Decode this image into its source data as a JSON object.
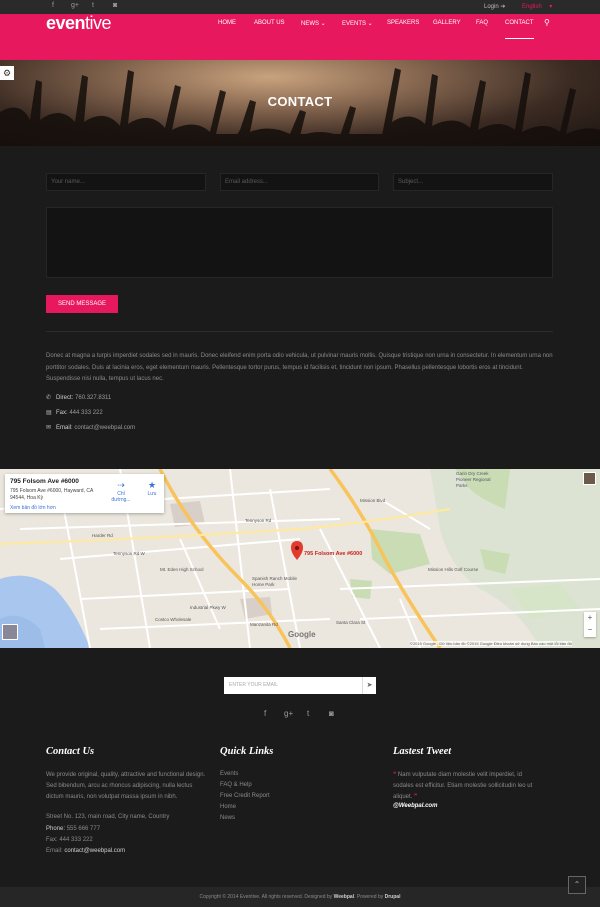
{
  "topbar": {
    "social": [
      {
        "icon": "facebook-icon",
        "glyph": "f"
      },
      {
        "icon": "google-plus-icon",
        "glyph": "g+"
      },
      {
        "icon": "twitter-icon",
        "glyph": "t"
      },
      {
        "icon": "instagram-icon",
        "glyph": "◙"
      }
    ],
    "login_label": "Login ➔",
    "language_label": "English"
  },
  "brand": {
    "logo_part1": "even",
    "logo_part2": "tive",
    "accent_color": "#e8185e"
  },
  "nav": {
    "items": [
      "HOME",
      "ABOUT US",
      "NEWS ⌄",
      "EVENTS ⌄",
      "SPEAKERS",
      "GALLERY",
      "FAQ",
      "CONTACT"
    ],
    "active": "CONTACT"
  },
  "hero": {
    "title": "CONTACT"
  },
  "form": {
    "name_placeholder": "Your name...",
    "email_placeholder": "Email address...",
    "subject_placeholder": "Subject...",
    "send_label": "SEND MESSAGE"
  },
  "contact": {
    "paragraph": "Donec at magna a turpis imperdiet sodales sed in mauris. Donec eleifend enim porta odio vehicula, ut pulvinar mauris mollis. Quisque tristique non urna in consectetur. In elementum urna non porttitor sodales. Duis at lacinia eros, eget elementum mauris. Pellentesque tortor purus, tempus id facilisis et, tincidunt non ipsum. Phasellus pellentesque lobortis eros at tincidunt. Suspendisse nisi nulla, tempus ut lacus nec.",
    "direct_label": "Direct:",
    "direct_value": "760.327.8311",
    "fax_label": "Fax:",
    "fax_value": "444 333 222",
    "email_label": "Email:",
    "email_value": "contact@weebpal.com"
  },
  "map": {
    "card_title": "795 Folsom Ave #6000",
    "card_address": "795 Folsom Ave #6000, Hayward, CA 94544, Hoa Kỳ",
    "card_link": "Xem bản đồ lớn hơn",
    "directions_label": "Chỉ đường...",
    "save_label": "Lưu",
    "pin_label": "795 Folsom Ave #6000",
    "street_labels": [
      "Mission Hills Golf Course",
      "Mt. Eden High School",
      "Spanish Ranch Mobile Home Park",
      "Costco Wholesale",
      "Garin Dry Creek Pioneer Regional Parks",
      "Tennyson Rd",
      "Industrial Pkwy W",
      "Mission Blvd",
      "Manzanita Rd",
      "Santa Clara St",
      "Harder Rd",
      "Tennyson Rd W"
    ],
    "zoom_in": "+",
    "zoom_out": "−",
    "footer_text": "©2015 Google - Dữ liệu bản đồ ©2015 Google   Điều khoản sử dụng   Báo cáo một lỗi bản đồ",
    "google_logo": "Google"
  },
  "newsletter": {
    "placeholder": "ENTER YOUR EMAIL"
  },
  "footer": {
    "contact_heading": "Contact Us",
    "contact_text": "We provide original, quality, attractive and functional design. Sed bibendum, arcu ac rhoncus adipiscing, nulla lectus dictum mauris, non volutpat massa ipsum in nibh.",
    "street": "Street No. 123, main road, City name, Country",
    "phone_label": "Phone:",
    "phone_value": "555 666 777",
    "fax_label": "Fax:",
    "fax_value": "444 333 222",
    "email_label": "Email:",
    "email_value": "contact@weebpal.com",
    "links_heading": "Quick Links",
    "links": [
      "Events",
      "FAQ & Help",
      "Free Credit Report",
      "Home",
      "News"
    ],
    "tweet_heading": "Lastest Tweet",
    "tweet_text": "Nam vulputate diam molestie velit imperdiet, id sodales est efficitur. Etiam molestie sollicitudin leo ut aliquet.",
    "tweet_handle": "@Weebpal.com"
  },
  "copyright": {
    "prefix": "Copyright © 2014 Eventive. All rights reserved. Designed by",
    "designer": "Weebpal",
    "mid": ". Powered by",
    "platform": "Drupal"
  }
}
